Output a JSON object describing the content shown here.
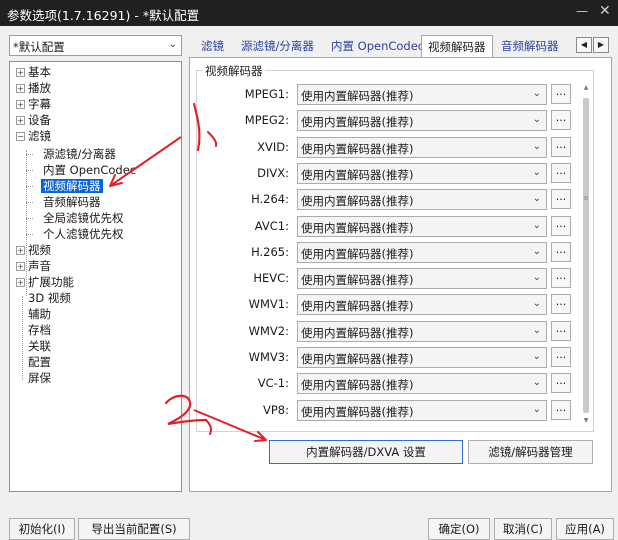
{
  "window": {
    "title": "参数选项(1.7.16291) - *默认配置",
    "minimize_glyph": "—",
    "close_glyph": "✕"
  },
  "profile": {
    "selected": "*默认配置"
  },
  "tree": {
    "items": [
      {
        "label": "基本",
        "box": "+"
      },
      {
        "label": "播放",
        "box": "+"
      },
      {
        "label": "字幕",
        "box": "+"
      },
      {
        "label": "设备",
        "box": "+"
      },
      {
        "label": "滤镜",
        "box": "−"
      },
      {
        "label": "源滤镜/分离器"
      },
      {
        "label": "内置 OpenCodec"
      },
      {
        "label": "视频解码器"
      },
      {
        "label": "音频解码器"
      },
      {
        "label": "全局滤镜优先权"
      },
      {
        "label": "个人滤镜优先权"
      },
      {
        "label": "视频",
        "box": "+"
      },
      {
        "label": "声音",
        "box": "+"
      },
      {
        "label": "扩展功能",
        "box": "+"
      },
      {
        "label": "3D 视频"
      },
      {
        "label": "辅助"
      },
      {
        "label": "存档"
      },
      {
        "label": "关联"
      },
      {
        "label": "配置"
      },
      {
        "label": "屏保"
      }
    ]
  },
  "tabs": [
    {
      "label": "滤镜"
    },
    {
      "label": "源滤镜/分离器"
    },
    {
      "label": "内置 OpenCodec"
    },
    {
      "label": "视频解码器"
    },
    {
      "label": "音频解码器"
    }
  ],
  "tab_scroll": {
    "left": "◀",
    "right": "▶"
  },
  "group_title": "视频解码器",
  "decoder_rows": [
    {
      "label": "MPEG1:",
      "value": "使用内置解码器(推荐)"
    },
    {
      "label": "MPEG2:",
      "value": "使用内置解码器(推荐)"
    },
    {
      "label": "XVID:",
      "value": "使用内置解码器(推荐)"
    },
    {
      "label": "DIVX:",
      "value": "使用内置解码器(推荐)"
    },
    {
      "label": "H.264:",
      "value": "使用内置解码器(推荐)"
    },
    {
      "label": "AVC1:",
      "value": "使用内置解码器(推荐)"
    },
    {
      "label": "H.265:",
      "value": "使用内置解码器(推荐)"
    },
    {
      "label": "HEVC:",
      "value": "使用内置解码器(推荐)"
    },
    {
      "label": "WMV1:",
      "value": "使用内置解码器(推荐)"
    },
    {
      "label": "WMV2:",
      "value": "使用内置解码器(推荐)"
    },
    {
      "label": "WMV3:",
      "value": "使用内置解码器(推荐)"
    },
    {
      "label": "VC-1:",
      "value": "使用内置解码器(推荐)"
    },
    {
      "label": "VP8:",
      "value": "使用内置解码器(推荐)"
    }
  ],
  "row_dots": "...",
  "buttons": {
    "dxva": "内置解码器/DXVA 设置",
    "manager": "滤镜/解码器管理"
  },
  "bottom_buttons": [
    {
      "label": "初始化(I)"
    },
    {
      "label": "导出当前配置(S)"
    },
    {
      "label": "确定(O)"
    },
    {
      "label": "取消(C)"
    },
    {
      "label": "应用(A)"
    }
  ],
  "annotations": {
    "step1": "1、",
    "step2": "2、"
  },
  "colors": {
    "annotation": "#e0202a",
    "selection": "#0a64d8",
    "link_tab": "#2a3fa0"
  }
}
